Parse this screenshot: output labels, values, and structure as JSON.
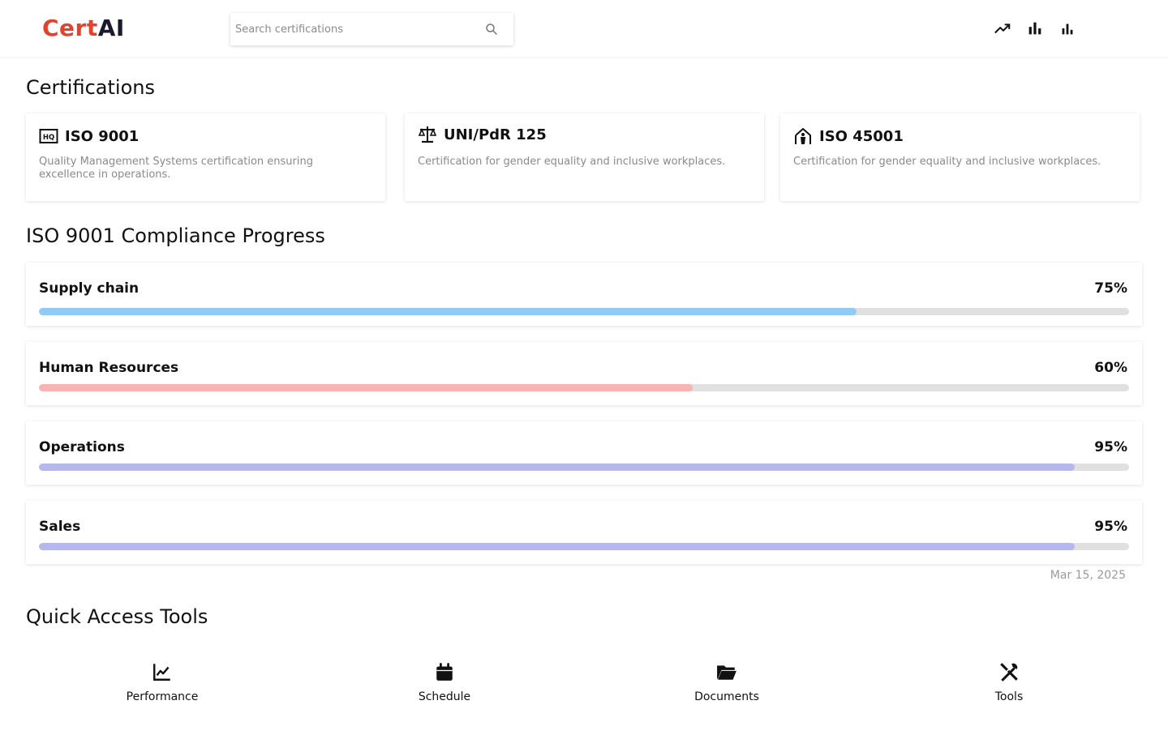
{
  "header": {
    "logo_part1": "Cert",
    "logo_part2": "AI",
    "search_placeholder": "Search certifications",
    "icons": [
      "trending-up-icon",
      "bar-chart-icon",
      "bar-chart-small-icon"
    ]
  },
  "certifications": {
    "title": "Certifications",
    "cards": [
      {
        "name": "ISO 9001",
        "icon": "hq-icon",
        "description": "Quality Management Systems certification ensuring excellence in operations."
      },
      {
        "name": "UNI/PdR 125",
        "icon": "balance-scale-icon",
        "description": "Certification for gender equality and inclusive workplaces."
      },
      {
        "name": "ISO 45001",
        "icon": "house-person-icon",
        "description": "Certification for gender equality and inclusive workplaces."
      }
    ]
  },
  "progress": {
    "title": "ISO 9001 Compliance Progress",
    "items": [
      {
        "label": "Supply chain",
        "value_text": "75%",
        "fraction": 0.75,
        "color": "#90caf9"
      },
      {
        "label": "Human Resources",
        "value_text": "60%",
        "fraction": 0.6,
        "color": "#f7b4b1"
      },
      {
        "label": "Operations",
        "value_text": "95%",
        "fraction": 0.95,
        "color": "#b4b8ec"
      },
      {
        "label": "Sales",
        "value_text": "95%",
        "fraction": 0.95,
        "color": "#b4b8ec"
      }
    ],
    "date": "Mar 15, 2025"
  },
  "tools": {
    "title": "Quick Access Tools",
    "items": [
      {
        "label": "Performance",
        "icon": "line-chart-icon"
      },
      {
        "label": "Schedule",
        "icon": "calendar-icon"
      },
      {
        "label": "Documents",
        "icon": "folder-open-icon"
      },
      {
        "label": "Tools",
        "icon": "tools-icon"
      }
    ]
  },
  "colors": {
    "brand_red": "#e1432f",
    "brand_dark": "#1a1a2e"
  }
}
